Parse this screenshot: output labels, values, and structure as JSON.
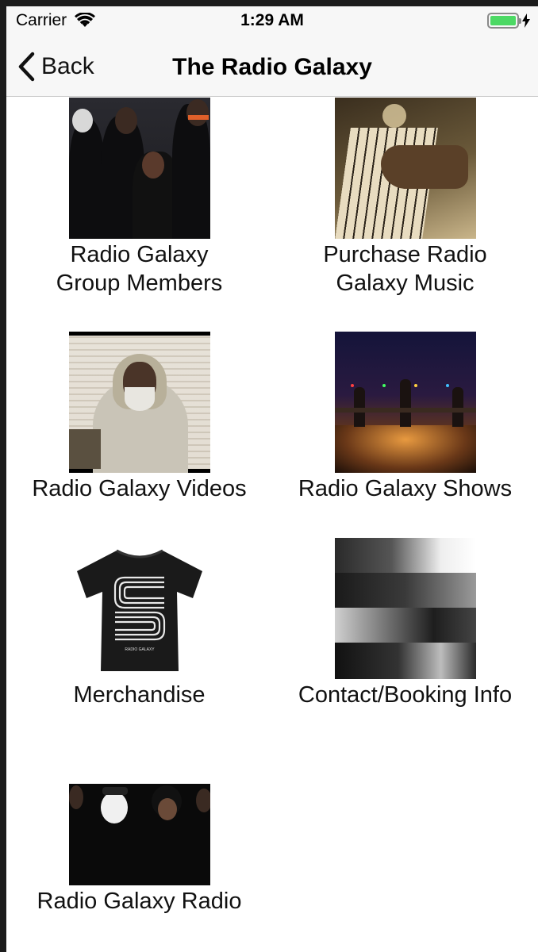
{
  "status_bar": {
    "carrier": "Carrier",
    "time": "1:29 AM",
    "battery_level": 1.0,
    "battery_color": "#4cd964"
  },
  "nav": {
    "back_label": "Back",
    "title": "The Radio Galaxy"
  },
  "tiles": [
    {
      "caption_line1": "Radio Galaxy",
      "caption_line2": "Group Members",
      "icon": "group-members-photo"
    },
    {
      "caption_line1": "Purchase Radio",
      "caption_line2": "Galaxy Music",
      "icon": "piano-photo"
    },
    {
      "caption_line1": "Radio Galaxy Videos",
      "caption_line2": "",
      "icon": "videos-photo"
    },
    {
      "caption_line1": "Radio Galaxy Shows",
      "caption_line2": "",
      "icon": "shows-photo"
    },
    {
      "caption_line1": "Merchandise",
      "caption_line2": "",
      "icon": "tshirt-photo"
    },
    {
      "caption_line1": "Contact/Booking Info",
      "caption_line2": "",
      "icon": "contact-collage-photo"
    },
    {
      "caption_line1": "Radio Galaxy Radio",
      "caption_line2": "",
      "icon": "radio-photo"
    }
  ],
  "merch_shirt_text": "RADIO GALAXY"
}
